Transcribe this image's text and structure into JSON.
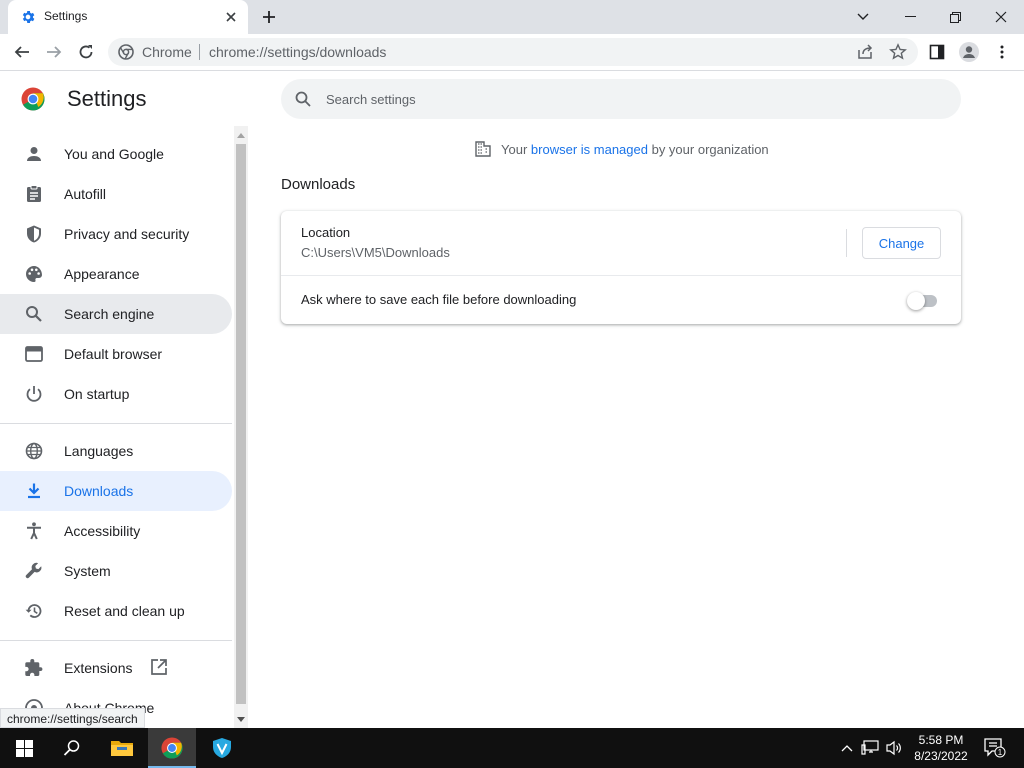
{
  "browser": {
    "tab_title": "Settings",
    "omnibox_chip": "Chrome",
    "url": "chrome://settings/downloads"
  },
  "settings": {
    "title": "Settings",
    "search_placeholder": "Search settings",
    "nav": [
      {
        "label": "You and Google",
        "icon": "person-icon"
      },
      {
        "label": "Autofill",
        "icon": "clipboard-icon"
      },
      {
        "label": "Privacy and security",
        "icon": "shield-icon"
      },
      {
        "label": "Appearance",
        "icon": "palette-icon"
      },
      {
        "label": "Search engine",
        "icon": "search-icon",
        "state": "hover"
      },
      {
        "label": "Default browser",
        "icon": "browser-window-icon"
      },
      {
        "label": "On startup",
        "icon": "power-icon"
      },
      {
        "label": "Languages",
        "icon": "globe-icon"
      },
      {
        "label": "Downloads",
        "icon": "download-icon",
        "state": "selected"
      },
      {
        "label": "Accessibility",
        "icon": "accessibility-icon"
      },
      {
        "label": "System",
        "icon": "wrench-icon"
      },
      {
        "label": "Reset and clean up",
        "icon": "restore-icon"
      },
      {
        "label": "Extensions",
        "icon": "puzzle-icon"
      },
      {
        "label": "About Chrome",
        "icon": "chrome-icon"
      }
    ],
    "managed_notice": {
      "prefix": "Your",
      "link": "browser is managed",
      "suffix": "by your organization"
    },
    "section_title": "Downloads",
    "location_label": "Location",
    "location_value": "C:\\Users\\VM5\\Downloads",
    "change_button": "Change",
    "ask_label": "Ask where to save each file before downloading",
    "ask_enabled": false
  },
  "status_bubble": "chrome://settings/search",
  "taskbar": {
    "time": "5:58 PM",
    "date": "8/23/2022",
    "notification_count": "1"
  },
  "colors": {
    "accent": "#1a73e8",
    "selected_bg": "#e8f0fe",
    "hover_bg": "#e8eaed",
    "tabstrip": "#dee1e6",
    "taskbar": "#101010"
  }
}
